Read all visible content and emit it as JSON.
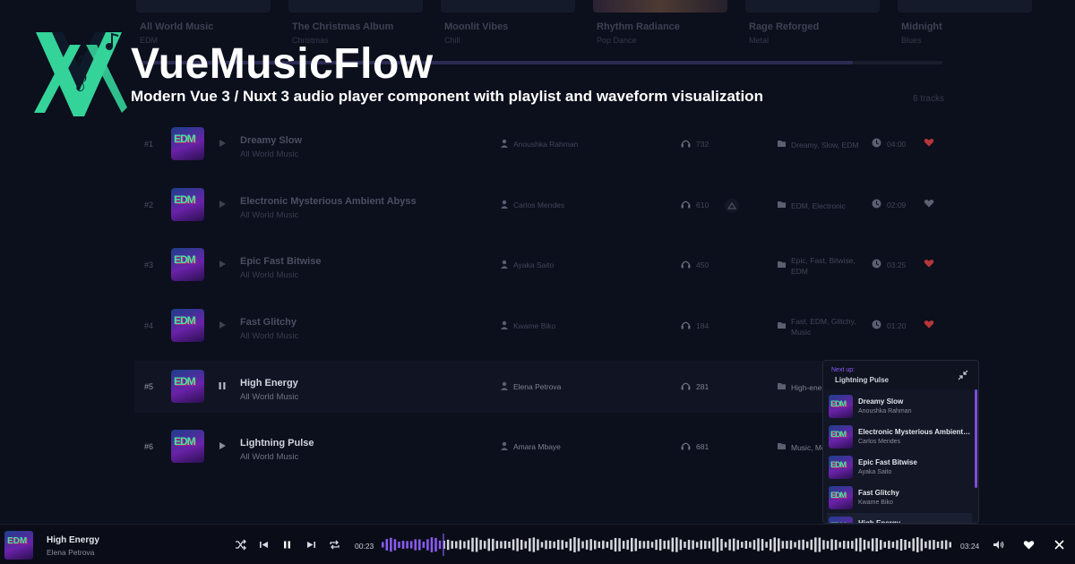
{
  "brand": {
    "name": "VueMusicFlow",
    "tagline": "Modern Vue 3 / Nuxt 3 audio player component with playlist and waveform visualization",
    "colors": {
      "logo_green": "#34d399",
      "logo_dark": "#0e1a2a",
      "accent_purple": "#8b5cf6",
      "heart_red": "#ef4444"
    }
  },
  "albums": [
    {
      "name": "All World Music",
      "genre": "EDM"
    },
    {
      "name": "The Christmas Album",
      "genre": "Christmas"
    },
    {
      "name": "Moonlit Vibes",
      "genre": "Chill"
    },
    {
      "name": "Rhythm Radiance",
      "genre": "Pop Dance"
    },
    {
      "name": "Rage Reforged",
      "genre": "Metal"
    },
    {
      "name": "Midnight",
      "genre": "Blues"
    }
  ],
  "playlist": {
    "count_label": "6 tracks",
    "thumb_text": "EDM",
    "tracks": [
      {
        "num": "#1",
        "title": "Dreamy Slow",
        "album": "All World Music",
        "artist": "Anoushka Rahman",
        "plays": "732",
        "tags": "Dreamy, Slow, EDM",
        "duration": "04:00",
        "liked": true
      },
      {
        "num": "#2",
        "title": "Electronic Mysterious Ambient Abyss",
        "album": "All World Music",
        "artist": "Carlos Mendes",
        "plays": "610",
        "tags": "EDM, Electronic",
        "duration": "02:09",
        "liked": false
      },
      {
        "num": "#3",
        "title": "Epic Fast Bitwise",
        "album": "All World Music",
        "artist": "Ayaka Saito",
        "plays": "450",
        "tags": "Epic, Fast, Bitwise, EDM",
        "duration": "03:25",
        "liked": true
      },
      {
        "num": "#4",
        "title": "Fast Glitchy",
        "album": "All World Music",
        "artist": "Kwame Biko",
        "plays": "184",
        "tags": "Fast, EDM, Glitchy, Music",
        "duration": "01:20",
        "liked": true
      },
      {
        "num": "#5",
        "title": "High Energy",
        "album": "All World Music",
        "artist": "Elena Petrova",
        "plays": "281",
        "tags": "High-ene",
        "duration": "",
        "liked": false
      },
      {
        "num": "#6",
        "title": "Lightning Pulse",
        "album": "All World Music",
        "artist": "Amara Mbaye",
        "plays": "681",
        "tags": "Music, Me Fast",
        "duration": "",
        "liked": false
      }
    ]
  },
  "next_up": {
    "label": "Next up:",
    "title": "Lightning Pulse",
    "items": [
      {
        "title": "Dreamy Slow",
        "artist": "Anoushka Rahman"
      },
      {
        "title": "Electronic Mysterious Ambient…",
        "artist": "Carlos Mendes"
      },
      {
        "title": "Epic Fast Bitwise",
        "artist": "Ayaka Saito"
      },
      {
        "title": "Fast Glitchy",
        "artist": "Kwame Biko"
      },
      {
        "title": "High Energy",
        "artist": ""
      }
    ]
  },
  "player": {
    "title": "High Energy",
    "artist": "Elena Petrova",
    "current_time": "00:23",
    "total_time": "03:24",
    "progress": 0.11,
    "liked": false
  }
}
